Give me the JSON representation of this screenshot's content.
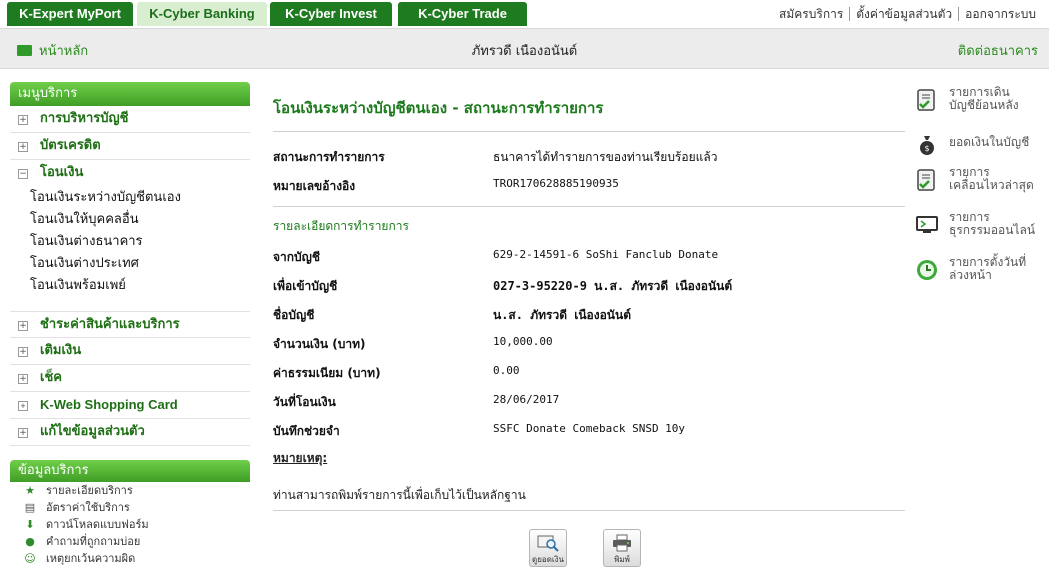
{
  "top_tabs": [
    "K-Expert MyPort",
    "K-Cyber Banking",
    "K-Cyber Invest",
    "K-Cyber Trade"
  ],
  "top_links": [
    "สมัครบริการ",
    "ตั้งค่าข้อมูลส่วนตัว",
    "ออกจากระบบ"
  ],
  "header": {
    "home": "หน้าหลัก",
    "username": "ภัทรวดี เนืองอนันต์",
    "contact": "ติดต่อธนาคาร"
  },
  "menu": {
    "title": "เมนูบริการ",
    "items": [
      {
        "label": "การบริหารบัญชี",
        "sign": "+"
      },
      {
        "label": "บัตรเครดิต",
        "sign": "+"
      },
      {
        "label": "โอนเงิน",
        "sign": "−"
      }
    ],
    "sub_items": [
      "โอนเงินระหว่างบัญชีตนเอง",
      "โอนเงินให้บุคคลอื่น",
      "โอนเงินต่างธนาคาร",
      "โอนเงินต่างประเทศ",
      "โอนเงินพร้อมเพย์"
    ],
    "more_items": [
      "ชำระค่าสินค้าและบริการ",
      "เติมเงิน",
      "เช็ค",
      "K-Web Shopping Card",
      "แก้ไขข้อมูลส่วนตัว"
    ]
  },
  "info": {
    "title": "ข้อมูลบริการ",
    "items": [
      {
        "label": "รายละเอียดบริการ",
        "icon": "star-icon"
      },
      {
        "label": "อัตราค่าใช้บริการ",
        "icon": "calculator-icon"
      },
      {
        "label": "ดาวน์โหลดแบบฟอร์ม",
        "icon": "download-icon"
      },
      {
        "label": "คำถามที่ถูกถามบ่อย",
        "icon": "faq-icon"
      },
      {
        "label": "เหตุยกเว้นความผิด",
        "icon": "handshake-icon"
      }
    ]
  },
  "main": {
    "title": "โอนเงินระหว่างบัญชีตนเอง - สถานะการทำรายการ",
    "status_label": "สถานะการทำรายการ",
    "status_value": "ธนาคารได้ทำรายการของท่านเรียบร้อยแล้ว",
    "ref_label": "หมายเลขอ้างอิง",
    "ref_value": "TROR170628885190935",
    "details_title": "รายละเอียดการทำรายการ",
    "rows": [
      {
        "label": "จากบัญชี",
        "value": "629-2-14591-6 SoShi Fanclub Donate"
      },
      {
        "label": "เพื่อเข้าบัญชี",
        "value": "027-3-95220-9 น.ส. ภัทรวดี เนืองอนันต์"
      },
      {
        "label": "ชื่อบัญชี",
        "value": "น.ส. ภัทรวดี เนืองอนันต์"
      },
      {
        "label": "จำนวนเงิน (บาท)",
        "value": "10,000.00"
      },
      {
        "label": "ค่าธรรมเนียม (บาท)",
        "value": "0.00"
      },
      {
        "label": "วันที่โอนเงิน",
        "value": "28/06/2017"
      },
      {
        "label": "บันทึกช่วยจำ",
        "value": "SSFC Donate Comeback SNSD 10y"
      }
    ],
    "note_label": "หมายเหตุ:",
    "note_text": "ท่านสามารถพิมพ์รายการนี้เพื่อเก็บไว้เป็นหลักฐาน",
    "btn_balance": "ดูยอดเงิน",
    "btn_print": "พิมพ์"
  },
  "right_links": [
    {
      "label1": "รายการเดิน",
      "label2": "บัญชีย้อนหลัง",
      "icon": "statement-icon"
    },
    {
      "label1": "ยอดเงินในบัญชี",
      "label2": "",
      "icon": "money-bag-icon"
    },
    {
      "label1": "รายการ",
      "label2": "เคลื่อนไหวล่าสุด",
      "icon": "recent-icon"
    },
    {
      "label1": "รายการ",
      "label2": "ธุรกรรมออนไลน์",
      "icon": "online-icon"
    },
    {
      "label1": "รายการตั้งวันที่",
      "label2": "ล่วงหน้า",
      "icon": "clock-icon"
    }
  ],
  "colors": {
    "brand": "#1f7b1f",
    "accent": "#3f9e25"
  }
}
